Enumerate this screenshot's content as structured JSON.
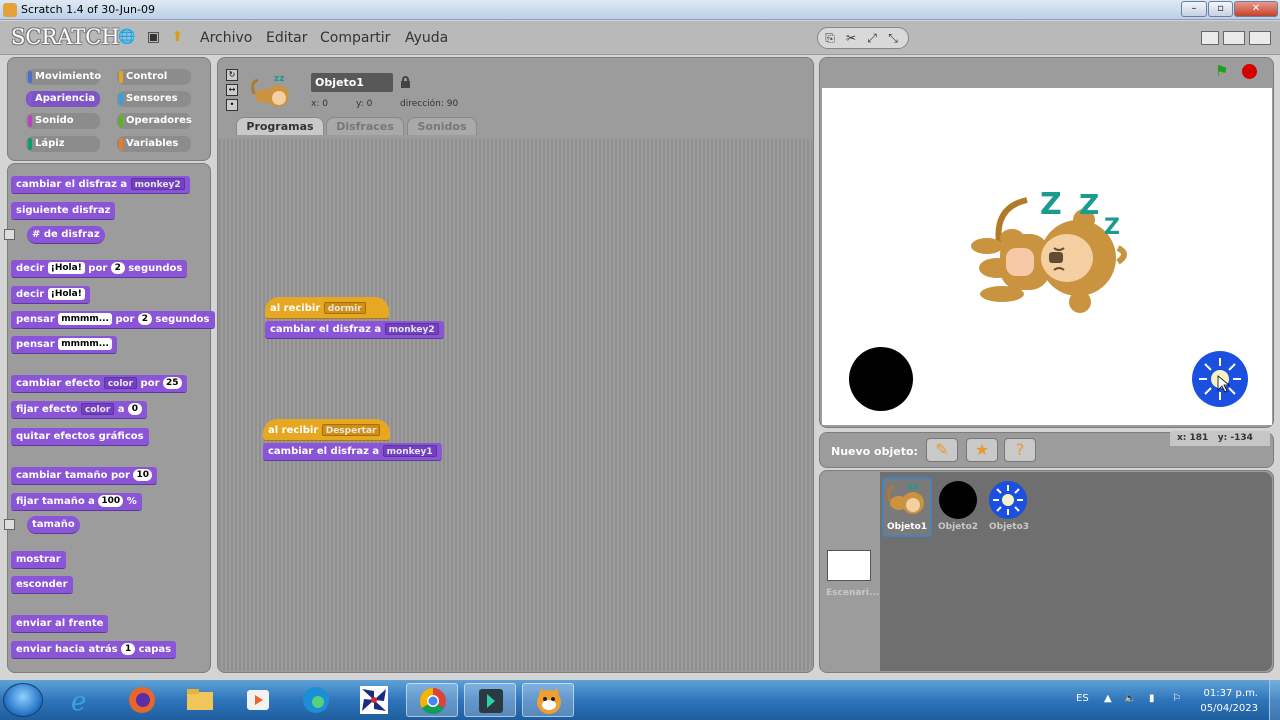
{
  "window": {
    "title": "Scratch 1.4 of 30-Jun-09"
  },
  "menubar": {
    "logo": "SCRATCH",
    "menus": [
      "Archivo",
      "Editar",
      "Compartir",
      "Ayuda"
    ]
  },
  "categories": [
    {
      "label": "Movimiento",
      "color": "#4a6cd4"
    },
    {
      "label": "Control",
      "color": "#e1a91a"
    },
    {
      "label": "Apariencia",
      "color": "#8a55d7"
    },
    {
      "label": "Sensores",
      "color": "#2ca5e2"
    },
    {
      "label": "Sonido",
      "color": "#bb42c3"
    },
    {
      "label": "Operadores",
      "color": "#5cb712"
    },
    {
      "label": "Lápiz",
      "color": "#0e9a6c"
    },
    {
      "label": "Variables",
      "color": "#ee7d16"
    }
  ],
  "palette": {
    "b1": {
      "text": "cambiar el disfraz a",
      "drop": "monkey2"
    },
    "b2": {
      "text": "siguiente disfraz"
    },
    "b3": {
      "text": "# de disfraz"
    },
    "b4": {
      "pre": "decir",
      "slot": "¡Hola!",
      "mid": "por",
      "num": "2",
      "post": "segundos"
    },
    "b5": {
      "pre": "decir",
      "slot": "¡Hola!"
    },
    "b6": {
      "pre": "pensar",
      "slot": "mmmm...",
      "mid": "por",
      "num": "2",
      "post": "segundos"
    },
    "b7": {
      "pre": "pensar",
      "slot": "mmmm..."
    },
    "b8": {
      "pre": "cambiar efecto",
      "drop": "color",
      "mid": "por",
      "num": "25"
    },
    "b9": {
      "pre": "fijar efecto",
      "drop": "color",
      "mid": "a",
      "num": "0"
    },
    "b10": {
      "text": "quitar efectos gráficos"
    },
    "b11": {
      "pre": "cambiar tamaño por",
      "num": "10"
    },
    "b12": {
      "pre": "fijar tamaño a",
      "num": "100",
      "post": "%"
    },
    "b13": {
      "text": "tamaño"
    },
    "b14": {
      "text": "mostrar"
    },
    "b15": {
      "text": "esconder"
    },
    "b16": {
      "text": "enviar al frente"
    },
    "b17": {
      "pre": "enviar hacia atrás",
      "num": "1",
      "post": "capas"
    }
  },
  "sprite_info": {
    "name": "Objeto1",
    "x": "x: 0",
    "y": "y: 0",
    "direction": "dirección: 90"
  },
  "tabs": [
    "Programas",
    "Disfraces",
    "Sonidos"
  ],
  "scripts": [
    {
      "hat": "al recibir",
      "hat_drop": "dormir",
      "block": "cambiar el disfraz a",
      "block_drop": "monkey2"
    },
    {
      "hat": "al recibir",
      "hat_drop": "Despertar",
      "block": "cambiar el disfraz a",
      "block_drop": "monkey1"
    }
  ],
  "stage": {
    "new_sprite_label": "Nuevo objeto:",
    "coords_x": "x: 181",
    "coords_y": "y: -134"
  },
  "sprites": [
    {
      "label": "Objeto1"
    },
    {
      "label": "Objeto2"
    },
    {
      "label": "Objeto3"
    }
  ],
  "stage_thumb_label": "Escenari...",
  "taskbar": {
    "lang": "ES",
    "time": "01:37 p.m.",
    "date": "05/04/2023"
  }
}
